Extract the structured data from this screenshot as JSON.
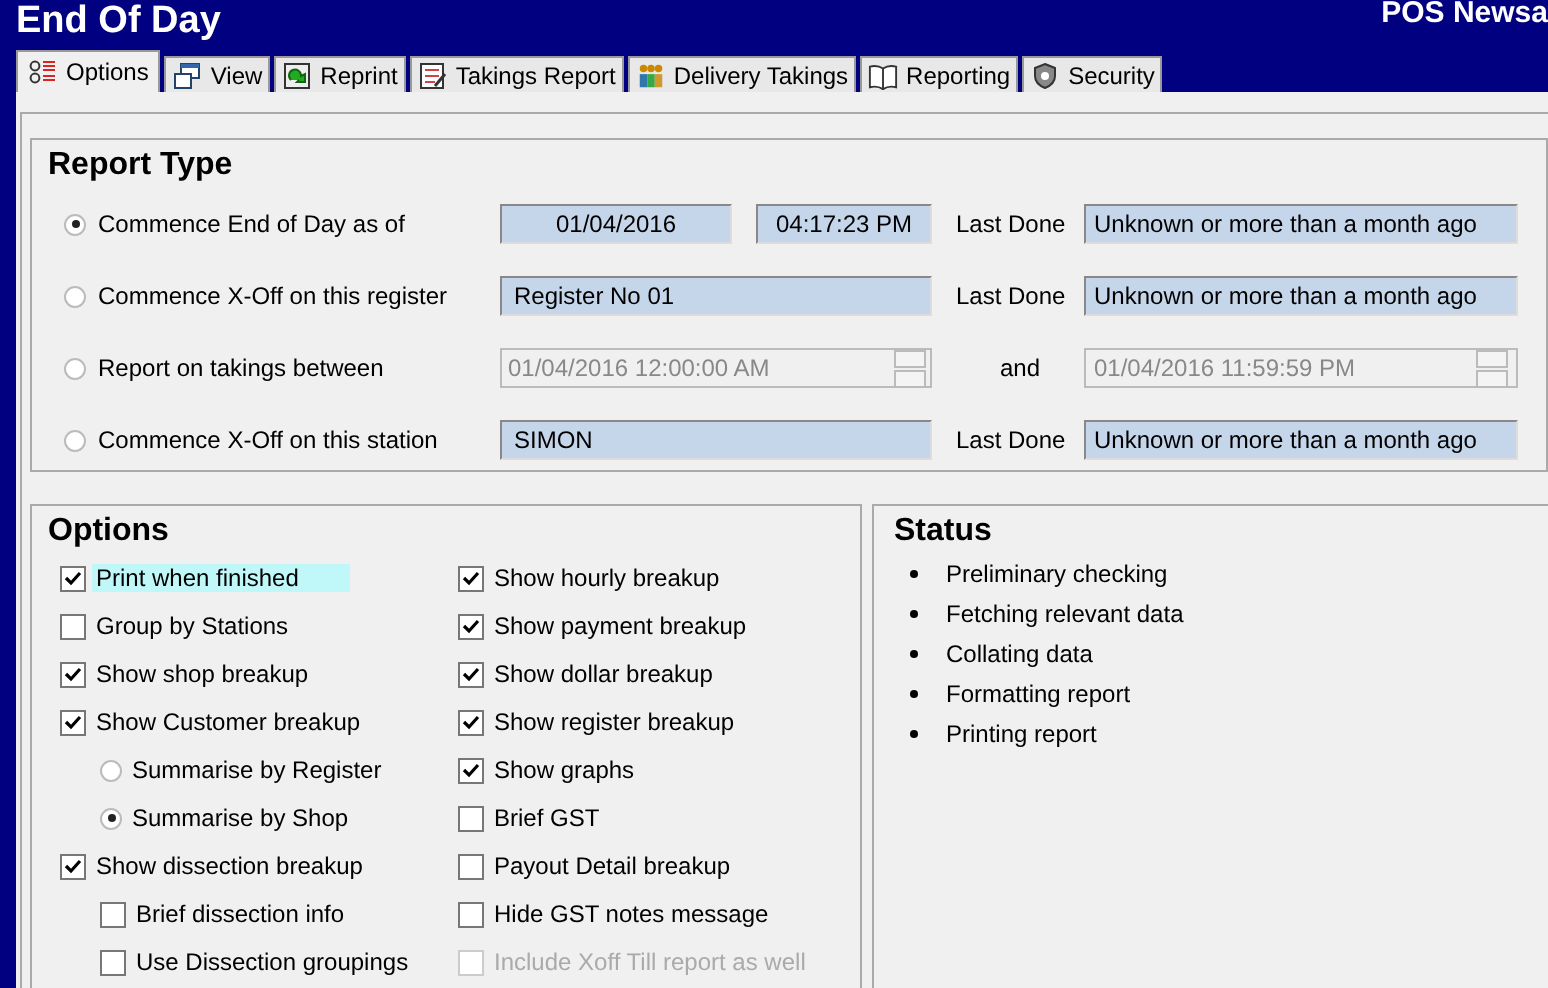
{
  "window": {
    "title": "End Of Day",
    "app_name": "POS Newsa"
  },
  "tabs": [
    {
      "label": "Options",
      "selected": true
    },
    {
      "label": "View",
      "selected": false
    },
    {
      "label": "Reprint",
      "selected": false
    },
    {
      "label": "Takings Report",
      "selected": false
    },
    {
      "label": "Delivery Takings",
      "selected": false
    },
    {
      "label": "Reporting",
      "selected": false
    },
    {
      "label": "Security",
      "selected": false
    }
  ],
  "report_type": {
    "title": "Report Type",
    "rows": [
      {
        "kind": "datetime",
        "label": "Commence End of Day as of",
        "selected": true,
        "date": "01/04/2016",
        "time": "04:17:23 PM",
        "last_done_label": "Last Done",
        "last_done": "Unknown or more than a month ago"
      },
      {
        "kind": "text",
        "label": "Commence X-Off on this register",
        "selected": false,
        "value": "Register No 01",
        "last_done_label": "Last Done",
        "last_done": "Unknown or more than a month ago"
      },
      {
        "kind": "range",
        "label": "Report on takings between",
        "selected": false,
        "from": "01/04/2016 12:00:00 AM",
        "joiner": "and",
        "to": "01/04/2016 11:59:59 PM"
      },
      {
        "kind": "text",
        "label": "Commence X-Off on this station",
        "selected": false,
        "value": "SIMON",
        "last_done_label": "Last Done",
        "last_done": "Unknown or more than a month ago"
      }
    ]
  },
  "options": {
    "title": "Options",
    "columns": [
      [
        {
          "kind": "checkbox",
          "label": "Print when finished",
          "checked": true,
          "focused": true,
          "disabled": false
        },
        {
          "kind": "checkbox",
          "label": "Group by Stations",
          "checked": false,
          "focused": false,
          "disabled": false
        },
        {
          "kind": "checkbox",
          "label": "Show shop breakup",
          "checked": true,
          "focused": false,
          "disabled": false
        },
        {
          "kind": "checkbox",
          "label": "Show Customer breakup",
          "checked": true,
          "focused": false,
          "disabled": false,
          "children": [
            {
              "kind": "radio",
              "label": "Summarise by Register",
              "selected": false
            },
            {
              "kind": "radio",
              "label": "Summarise by Shop",
              "selected": true
            }
          ]
        },
        {
          "kind": "checkbox",
          "label": "Show dissection breakup",
          "checked": true,
          "focused": false,
          "disabled": false,
          "children": [
            {
              "kind": "checkbox",
              "label": "Brief dissection info",
              "checked": false,
              "focused": false,
              "disabled": false
            },
            {
              "kind": "checkbox",
              "label": "Use Dissection groupings",
              "checked": false,
              "focused": false,
              "disabled": false
            }
          ]
        }
      ],
      [
        {
          "kind": "checkbox",
          "label": "Show hourly breakup",
          "checked": true,
          "focused": false,
          "disabled": false
        },
        {
          "kind": "checkbox",
          "label": "Show payment breakup",
          "checked": true,
          "focused": false,
          "disabled": false
        },
        {
          "kind": "checkbox",
          "label": "Show dollar breakup",
          "checked": true,
          "focused": false,
          "disabled": false
        },
        {
          "kind": "checkbox",
          "label": "Show register breakup",
          "checked": true,
          "focused": false,
          "disabled": false
        },
        {
          "kind": "checkbox",
          "label": "Show graphs",
          "checked": true,
          "focused": false,
          "disabled": false
        },
        {
          "kind": "checkbox",
          "label": "Brief GST",
          "checked": false,
          "focused": false,
          "disabled": false
        },
        {
          "kind": "checkbox",
          "label": "Payout Detail breakup",
          "checked": false,
          "focused": false,
          "disabled": false
        },
        {
          "kind": "checkbox",
          "label": "Hide GST notes message",
          "checked": false,
          "focused": false,
          "disabled": false
        },
        {
          "kind": "checkbox",
          "label": "Include Xoff Till report as well",
          "checked": false,
          "focused": false,
          "disabled": true
        }
      ]
    ]
  },
  "status": {
    "title": "Status",
    "steps": [
      "Preliminary checking",
      "Fetching relevant data",
      "Collating data",
      "Formatting report",
      "Printing report"
    ]
  }
}
